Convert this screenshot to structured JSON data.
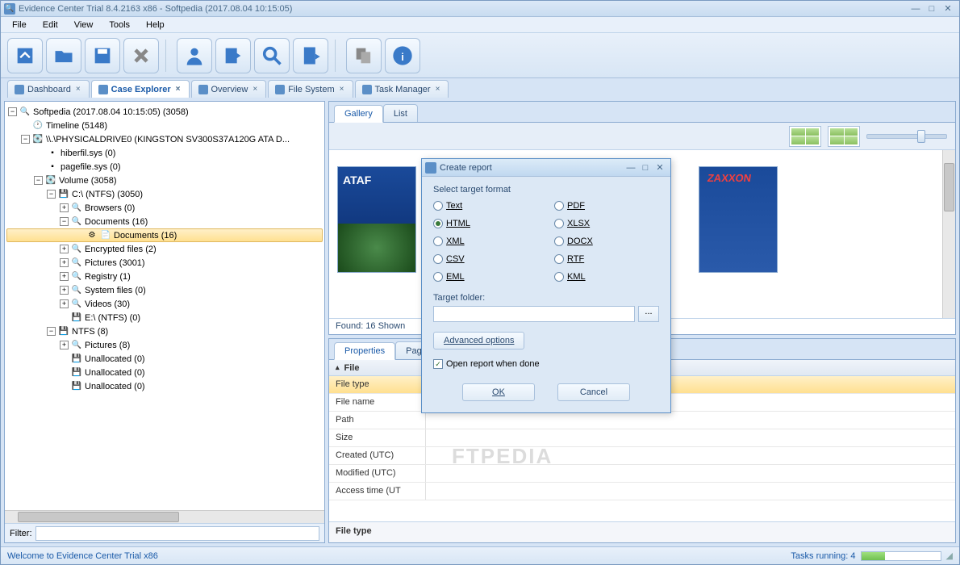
{
  "window": {
    "title": "Evidence Center Trial 8.4.2163 x86 - Softpedia (2017.08.04 10:15:05)"
  },
  "menu": {
    "file": "File",
    "edit": "Edit",
    "view": "View",
    "tools": "Tools",
    "help": "Help"
  },
  "tabs": {
    "dashboard": "Dashboard",
    "case_explorer": "Case Explorer",
    "overview": "Overview",
    "file_system": "File System",
    "task_manager": "Task Manager"
  },
  "tree": {
    "n0": "Softpedia (2017.08.04 10:15:05) (3058)",
    "n1": "Timeline (5148)",
    "n2": "\\\\.\\PHYSICALDRIVE0 (KINGSTON SV300S37A120G ATA D...",
    "n3": "hiberfil.sys (0)",
    "n4": "pagefile.sys (0)",
    "n5": "Volume (3058)",
    "n6": "C:\\ (NTFS) (3050)",
    "n7": "Browsers (0)",
    "n8": "Documents (16)",
    "n9": "Documents (16)",
    "n10": "Encrypted files (2)",
    "n11": "Pictures (3001)",
    "n12": "Registry (1)",
    "n13": "System files (0)",
    "n14": "Videos (30)",
    "n15": "E:\\ (NTFS) (0)",
    "n16": "NTFS (8)",
    "n17": "Pictures (8)",
    "n18": "Unallocated (0)",
    "n19": "Unallocated (0)",
    "n20": "Unallocated (0)"
  },
  "filter_label": "Filter:",
  "gallery": {
    "tab_gallery": "Gallery",
    "tab_list": "List",
    "status": "Found: 16   Shown"
  },
  "props": {
    "tab_properties": "Properties",
    "tab_pages": "Page",
    "group": "File",
    "rows": {
      "r0": "File type",
      "r1": "File name",
      "r2": "Path",
      "r3": "Size",
      "r4": "Created (UTC)",
      "r5": "Modified (UTC)",
      "r6": "Access time (UT"
    },
    "footer": "File type"
  },
  "dialog": {
    "title": "Create report",
    "select_format": "Select target format",
    "formats": {
      "text": "Text",
      "pdf": "PDF",
      "html": "HTML",
      "xlsx": "XLSX",
      "xml": "XML",
      "docx": "DOCX",
      "csv": "CSV",
      "rtf": "RTF",
      "eml": "EML",
      "kml": "KML"
    },
    "target_folder": "Target folder:",
    "browse": "...",
    "advanced": "Advanced options",
    "open_when_done": "Open report when done",
    "ok": "OK",
    "cancel": "Cancel"
  },
  "status": {
    "welcome": "Welcome to Evidence Center Trial x86",
    "tasks": "Tasks running: 4"
  },
  "watermark": "FTPEDIA"
}
